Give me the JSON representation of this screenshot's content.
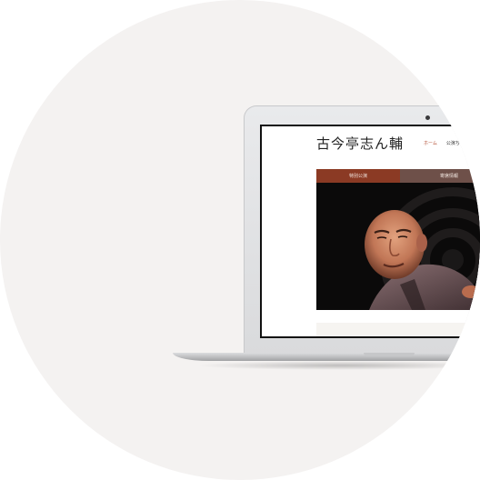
{
  "site": {
    "title": "古今亭志ん輔",
    "nav": [
      {
        "label": "ホーム",
        "active": true
      },
      {
        "label": "公演ち"
      }
    ],
    "tabs": [
      {
        "label": "特別公演"
      },
      {
        "label": "寄席情報"
      }
    ]
  },
  "colors": {
    "background_circle": "#f4f2f1",
    "tab_active": "#8b3a24",
    "tab_inactive": "#6e5049",
    "nav_active": "#b14a2f"
  },
  "icons": {
    "camera": "laptop-camera-icon"
  }
}
